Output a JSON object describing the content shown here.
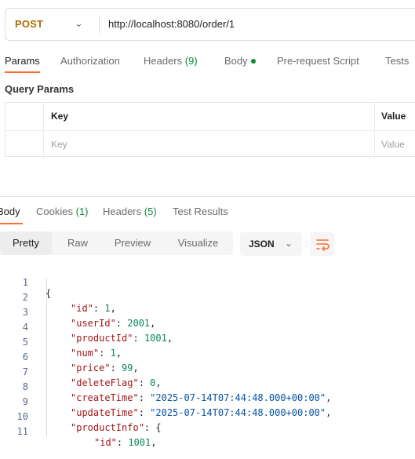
{
  "request": {
    "method": "POST",
    "url": "http://localhost:8080/order/1",
    "tabs": [
      {
        "label": "Params"
      },
      {
        "label": "Authorization"
      },
      {
        "label": "Headers",
        "count": "(9)"
      },
      {
        "label": "Body"
      },
      {
        "label": "Pre-request Script"
      },
      {
        "label": "Tests"
      }
    ]
  },
  "query_params": {
    "title": "Query Params",
    "headers": [
      "Key",
      "Value"
    ],
    "placeholders": [
      "Key",
      "Value"
    ]
  },
  "response": {
    "tabs": [
      {
        "label": "Body"
      },
      {
        "label": "Cookies",
        "count": "(1)"
      },
      {
        "label": "Headers",
        "count": "(5)"
      },
      {
        "label": "Test Results"
      }
    ],
    "view_modes": [
      "Pretty",
      "Raw",
      "Preview",
      "Visualize"
    ],
    "format": "JSON",
    "line_numbers": [
      "1",
      "2",
      "3",
      "4",
      "5",
      "6",
      "7",
      "8",
      "9",
      "10",
      "11"
    ],
    "code": {
      "open": "{",
      "id_key": "\"id\"",
      "id_val": "1",
      "userId_key": "\"userId\"",
      "userId_val": "2001",
      "productId_key": "\"productId\"",
      "productId_val": "1001",
      "num_key": "\"num\"",
      "num_val": "1",
      "price_key": "\"price\"",
      "price_val": "99",
      "deleteFlag_key": "\"deleteFlag\"",
      "deleteFlag_val": "0",
      "createTime_key": "\"createTime\"",
      "createTime_val": "\"2025-07-14T07:44:48.000+00:00\"",
      "updateTime_key": "\"updateTime\"",
      "updateTime_val": "\"2025-07-14T07:44:48.000+00:00\"",
      "productInfo_key": "\"productInfo\"",
      "productInfo_open": "{",
      "inner_id_key": "\"id\"",
      "inner_id_val": "1001"
    }
  }
}
